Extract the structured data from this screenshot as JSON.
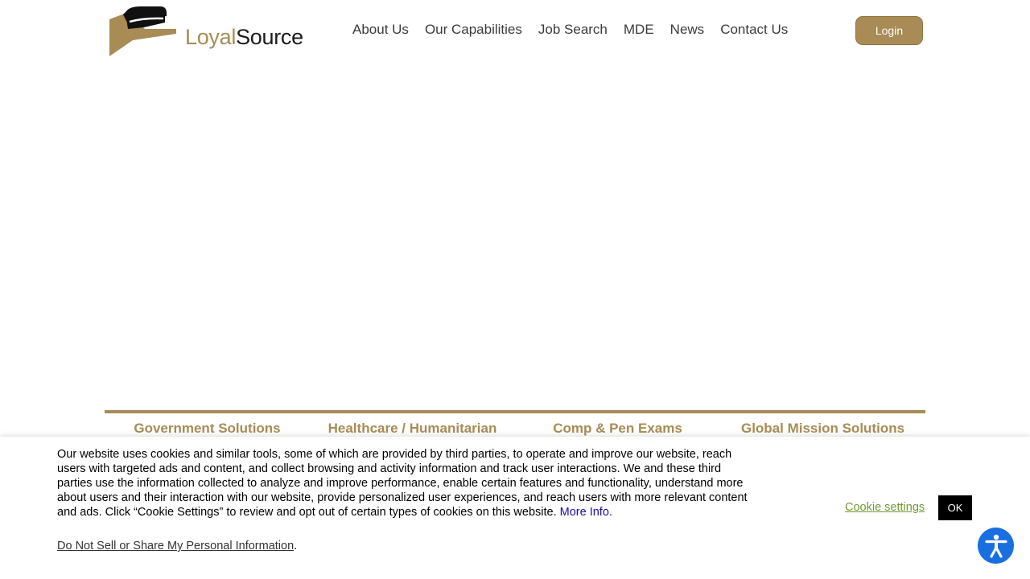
{
  "brand": {
    "name_part1": "Loyal",
    "name_part2": "Source",
    "accent_color": "#a88b55",
    "icon": "loyalsource-hat-logo"
  },
  "nav": {
    "items": [
      {
        "label": "About Us"
      },
      {
        "label": "Our Capabilities"
      },
      {
        "label": "Job Search"
      },
      {
        "label": "MDE"
      },
      {
        "label": "News"
      },
      {
        "label": "Contact Us"
      }
    ],
    "login_label": "Login"
  },
  "solutions": {
    "tabs": [
      {
        "label": "Government Solutions"
      },
      {
        "label": "Healthcare / Humanitarian"
      },
      {
        "label": "Comp & Pen Exams"
      },
      {
        "label": "Global Mission Solutions"
      }
    ]
  },
  "cookie_banner": {
    "text": "Our website uses cookies and similar tools, some of which are provided by third parties, to operate and improve our website, reach users with targeted ads and content, and collect browsing and activity information and track user interactions. We and these third parties use the information collected to analyze and improve performance, enable certain features and functionality, understand more about users and their interaction with our website, provide personalized user experiences, and reach users with more relevant content and ads. Click “Cookie Settings” to review and opt out of certain types of cookies on this website.",
    "more_info_label": "More Info.",
    "do_not_sell_label": "Do Not Sell or Share My Personal Information",
    "do_not_sell_suffix": ".",
    "settings_label": "Cookie settings",
    "ok_label": "OK",
    "settings_color": "#6f9a2d"
  },
  "accessibility": {
    "icon": "accessibility-person-icon",
    "color": "#1a6fe0"
  }
}
